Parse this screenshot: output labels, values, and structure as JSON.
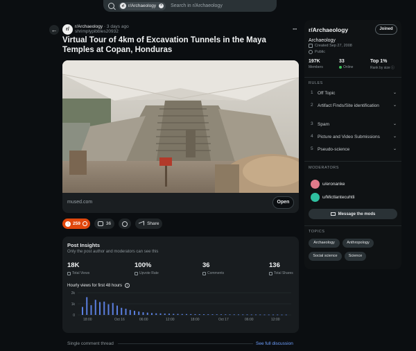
{
  "search": {
    "chip_label": "r/Archaeology",
    "chip_icon": "r/",
    "placeholder": "Search in r/Archaeology"
  },
  "post": {
    "subreddit": "r/Archaeology",
    "age": "3 days ago",
    "author": "shrimplypibbles20932",
    "title": "Virtual Tour of 4km of Excavation Tunnels in the Maya Temples at Copan, Honduras",
    "link_domain": "mused.com",
    "open_label": "Open",
    "votes": "259",
    "comments": "36",
    "share_label": "Share",
    "accent": "#e0470c"
  },
  "insights": {
    "title": "Post Insights",
    "subtitle": "Only the post author and moderators can see this",
    "stats": [
      {
        "value": "18K",
        "label": "Total Views"
      },
      {
        "value": "100%",
        "label": "Upvote Rate"
      },
      {
        "value": "36",
        "label": "Comments"
      },
      {
        "value": "136",
        "label": "Total Shares"
      }
    ],
    "chart_title": "Hourly views for first 48 hours"
  },
  "chart_data": {
    "type": "bar",
    "title": "Hourly views for first 48 hours",
    "yticks": [
      "2k",
      "1k",
      "0"
    ],
    "ylim": [
      0,
      2500
    ],
    "xticks": [
      "18:00",
      "Oct 16",
      "06:00",
      "12:00",
      "18:00",
      "Oct 17",
      "06:00",
      "12:00"
    ],
    "values": [
      900,
      2000,
      1100,
      1700,
      1450,
      1500,
      1200,
      1350,
      1050,
      800,
      700,
      560,
      460,
      380,
      300,
      260,
      210,
      180,
      170,
      150,
      140,
      120,
      110,
      100,
      95,
      90,
      85,
      80,
      75,
      70,
      70,
      65,
      60,
      60,
      55,
      55,
      50,
      50,
      50,
      45,
      45,
      45,
      40,
      40,
      40,
      40,
      35,
      35
    ],
    "bar_color": "#5b7fe0"
  },
  "thread": {
    "label": "Single comment thread",
    "see_full": "See full discussion"
  },
  "sidebar": {
    "header": "r/Archaeology",
    "joined_label": "Joined",
    "name": "Archaeology",
    "created": "Created Sep 27, 2008",
    "visibility": "Public",
    "members_value": "197K",
    "members_label": "Members",
    "online_value": "33",
    "online_label": "Online",
    "rank_value": "Top 1%",
    "rank_label": "Rank by size",
    "rules_label": "RULES",
    "rules": [
      {
        "num": "1",
        "text": "Off Topic"
      },
      {
        "num": "2",
        "text": "Artifact Finds/Site identification"
      },
      {
        "num": "3",
        "text": "Spam"
      },
      {
        "num": "4",
        "text": "Picture and Video Submissions"
      },
      {
        "num": "5",
        "text": "Pseudo-science"
      }
    ],
    "moderators_label": "MODERATORS",
    "moderators": [
      {
        "name": "u/eronanke"
      },
      {
        "name": "u/Mictlantecuhtli"
      }
    ],
    "message_mods": "Message the mods",
    "topics_label": "TOPICS",
    "topics": [
      "Archaeology",
      "Anthropology",
      "Social science",
      "Science"
    ]
  }
}
